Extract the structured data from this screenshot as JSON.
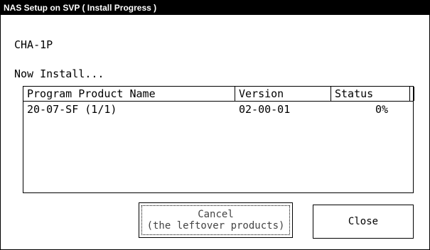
{
  "window": {
    "title": "NAS Setup on SVP ( Install Progress )"
  },
  "device": "CHA-1P",
  "status_line": "Now Install...",
  "table": {
    "columns": [
      "Program Product Name",
      "Version",
      "Status"
    ],
    "rows": [
      {
        "name": "20-07-SF (1/1)",
        "version": "02-00-01",
        "status": "0%"
      }
    ]
  },
  "buttons": {
    "cancel_line1": "Cancel",
    "cancel_line2": "(the leftover products)",
    "close": "Close"
  }
}
